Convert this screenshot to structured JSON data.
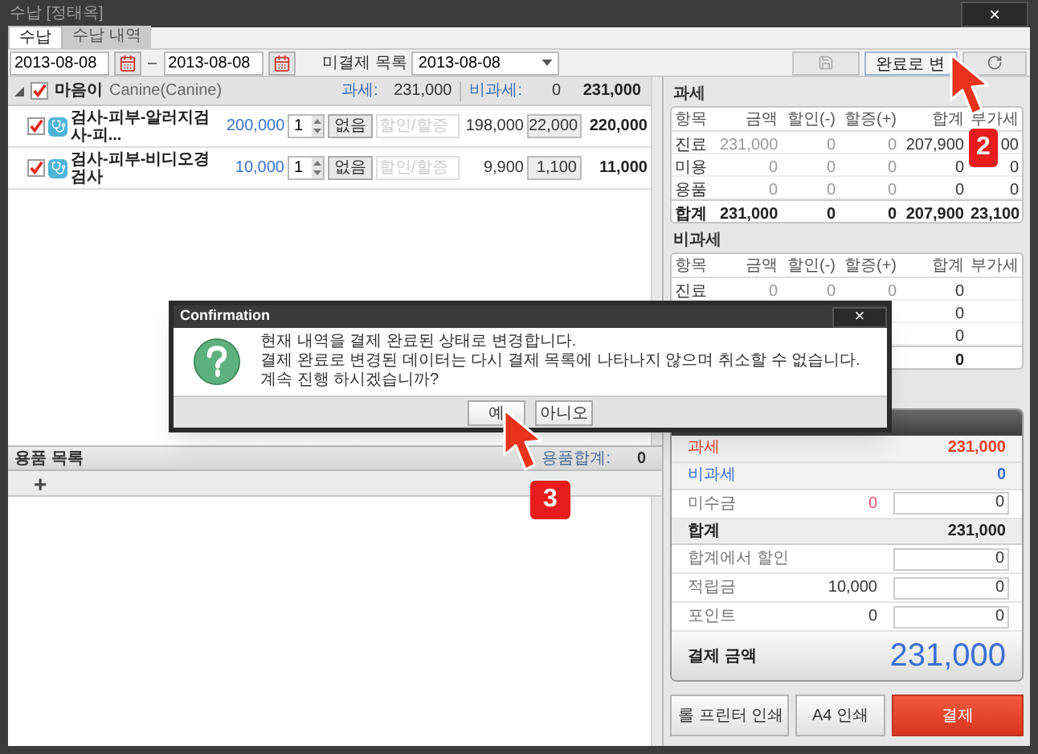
{
  "window": {
    "title": "수납 [정태옥]",
    "close": "×"
  },
  "tabs": [
    {
      "label": "수납",
      "selected": true
    },
    {
      "label": "수납 내역",
      "selected": false
    }
  ],
  "toolbar": {
    "date_from": "2013-08-08",
    "separator": "–",
    "date_to": "2013-08-08",
    "unpaid_label": "미결제 목록",
    "unpaid_date": "2013-08-08",
    "complete_button": "완료로 변"
  },
  "patient": {
    "expanded": true,
    "checked": true,
    "name": "마음이",
    "species": "Canine(Canine)",
    "taxable_label": "과세:",
    "taxable": "231,000",
    "nontaxable_label": "비과세:",
    "nontaxable": "0",
    "total": "231,000"
  },
  "items": [
    {
      "checked": true,
      "name": "검사-피부-알러지검사-피...",
      "price": "200,000",
      "qty": "1",
      "discount_button": "없음",
      "discount_placeholder": "할인/할증",
      "amount": "198,000",
      "vat": "22,000",
      "total": "220,000"
    },
    {
      "checked": true,
      "name": "검사-피부-비디오경검사",
      "price": "10,000",
      "qty": "1",
      "discount_button": "없음",
      "discount_placeholder": "할인/할증",
      "amount": "9,900",
      "vat": "1,100",
      "total": "11,000"
    }
  ],
  "supplies": {
    "title": "용품 목록",
    "total_label": "용품합계:",
    "total": "0",
    "add": "+"
  },
  "taxable": {
    "title": "과세",
    "columns": [
      "항목",
      "금액",
      "할인(-)",
      "할증(+)",
      "합계",
      "부가세"
    ],
    "rows": [
      {
        "kind": "row",
        "cells": [
          "진료",
          "231,000",
          "0",
          "0",
          "207,900",
          "00"
        ]
      },
      {
        "kind": "row",
        "cells": [
          "미용",
          "0",
          "0",
          "0",
          "0",
          "0"
        ]
      },
      {
        "kind": "row",
        "cells": [
          "용품",
          "0",
          "0",
          "0",
          "0",
          "0"
        ]
      },
      {
        "kind": "total",
        "cells": [
          "합계",
          "231,000",
          "0",
          "0",
          "207,900",
          "23,100"
        ]
      }
    ]
  },
  "nontaxable": {
    "title": "비과세",
    "columns": [
      "항목",
      "금액",
      "할인(-)",
      "할증(+)",
      "합계",
      "부가세"
    ],
    "rows": [
      {
        "kind": "row",
        "cells": [
          "진료",
          "0",
          "0",
          "0",
          "0",
          null
        ]
      },
      {
        "kind": "row",
        "cells": [
          null,
          null,
          null,
          null,
          "0",
          null
        ]
      },
      {
        "kind": "row",
        "cells": [
          null,
          null,
          null,
          null,
          "0",
          null
        ]
      },
      {
        "kind": "total",
        "cells": [
          null,
          null,
          null,
          null,
          "0",
          null
        ]
      }
    ]
  },
  "summary": {
    "rows": [
      {
        "kind": "tax",
        "label": "과세",
        "value": "231,000",
        "color": "#e8412c"
      },
      {
        "kind": "tax",
        "label": "비과세",
        "value": "0",
        "color": "#3b6fd6"
      },
      {
        "kind": "input",
        "label": "미수금",
        "amount": "0",
        "input": "0",
        "color": "#f0506e"
      },
      {
        "kind": "total",
        "label": "합계",
        "value": "231,000"
      },
      {
        "kind": "input",
        "label": "합계에서 할인",
        "input": "0"
      },
      {
        "kind": "input",
        "label": "적립금",
        "amount": "10,000",
        "input": "0"
      },
      {
        "kind": "input",
        "label": "포인트",
        "amount": "0",
        "input": "0"
      }
    ],
    "payment_label": "결제 금액",
    "payment": "231,000"
  },
  "buttons": [
    {
      "label": "롤 프린터 인쇄",
      "kind": "default"
    },
    {
      "label": "A4 인쇄",
      "kind": "default"
    },
    {
      "label": "결제",
      "kind": "primary"
    }
  ],
  "dialog": {
    "title": "Confirmation",
    "close": "×",
    "lines": [
      "현재 내역을 결제 완료된 상태로 변경합니다.",
      "결제 완료로 변경된 데이터는 다시 결제 목록에 나타나지 않으며 취소할 수 없습니다. 계속 진행 하시겠습니까?"
    ],
    "buttons": [
      "예",
      "아니오"
    ]
  },
  "annotations": [
    {
      "label": "2"
    },
    {
      "label": "3"
    }
  ]
}
